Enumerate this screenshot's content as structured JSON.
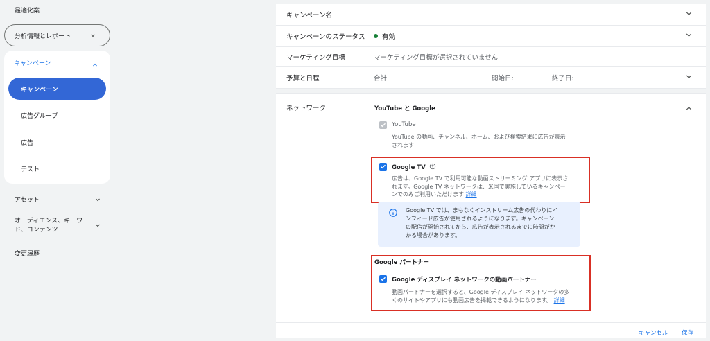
{
  "sidebar": {
    "top_item": "最適化案",
    "analytics_label": "分析情報とレポート",
    "campaign_header": "キャンペーン",
    "sub_items": [
      "キャンペーン",
      "広告グループ",
      "広告",
      "テスト"
    ],
    "assets_label": "アセット",
    "audience_label": "オーディエンス、キーワー",
    "audience_label_2": "ド、コンテンツ",
    "history_label": "変更履歴"
  },
  "rows": {
    "campaign_name_label": "キャンペーン名",
    "status_label": "キャンペーンのステータス",
    "status_value": "有効",
    "goal_label": "マーケティング目標",
    "goal_value": "マーケティング目標が選択されていません",
    "budget_label": "予算と日程",
    "budget_total": "合計",
    "start_label": "開始日:",
    "end_label": "終了日:"
  },
  "network": {
    "label": "ネットワーク",
    "section_title": "YouTube と Google",
    "youtube_label": "YouTube",
    "youtube_desc_1": "YouTube の動画、チャンネル、ホーム、および検索結果に広告が表示",
    "youtube_desc_2": "されます",
    "googletv_label": "Google TV",
    "googletv_desc_1": "広告は、Google TV で利用可能な動画ストリーミング アプリに表示さ",
    "googletv_desc_2": "れます。Google TV ネットワークは、米国で実施しているキャンペー",
    "googletv_desc_3": "ンでのみご利用いただけます",
    "details_link": "詳細",
    "info_1": "Google TV では、まもなくインストリーム広告の代わりにイ",
    "info_2": "ンフィード広告が使用されるようになります。キャンペーン",
    "info_3": "の配信が開始されてから、広告が表示されるまでに時間がか",
    "info_4": "かる場合があります。",
    "partners_title": "Google パートナー",
    "partners_label": "Google ディスプレイ ネットワークの動画パートナー",
    "partners_desc_1": "動画パートナーを選択すると、Google ディスプレイ ネットワークの多",
    "partners_desc_2": "くのサイトやアプリにも動画広告を掲載できるようになります。",
    "partners_details_link": "詳細"
  },
  "footer": {
    "cancel_label": "キャンセル",
    "save_label": "保存"
  },
  "colors": {
    "accent": "#1a73e8",
    "active_nav": "#3367d6",
    "status_green": "#188038",
    "highlight_red": "#d93025"
  },
  "icons": [
    "chevron-down-icon",
    "chevron-up-icon",
    "info-icon",
    "help-icon",
    "check-icon"
  ]
}
